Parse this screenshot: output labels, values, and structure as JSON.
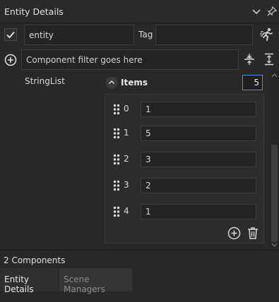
{
  "header": {
    "title": "Entity Details"
  },
  "entity": {
    "enabled": true,
    "name": "entity",
    "tag_label": "Tag",
    "tag_value": ""
  },
  "filter": {
    "placeholder": "Component filter goes here"
  },
  "component": {
    "field_label": "StringList"
  },
  "items": {
    "label": "Items",
    "count": "5",
    "rows": [
      {
        "index": "0",
        "value": "1"
      },
      {
        "index": "1",
        "value": "5"
      },
      {
        "index": "2",
        "value": "3"
      },
      {
        "index": "3",
        "value": "2"
      },
      {
        "index": "4",
        "value": "1"
      }
    ]
  },
  "footer": {
    "components_count": "2 Components",
    "tabs": [
      {
        "label": "Entity Details",
        "active": true
      },
      {
        "label": "Scene Managers",
        "active": false
      }
    ]
  },
  "icons": {
    "collapse": "chevron-down-icon",
    "pin": "pin-icon",
    "enabled": "checkmark-icon",
    "run": "running-person-icon",
    "add_component": "plus-circle-icon",
    "collapse_all": "collapse-all-icon",
    "expand_all": "expand-all-icon",
    "items_toggle": "chevron-up-icon",
    "drag": "drag-handle-icon",
    "add_item": "plus-circle-icon",
    "delete_item": "trash-icon"
  }
}
